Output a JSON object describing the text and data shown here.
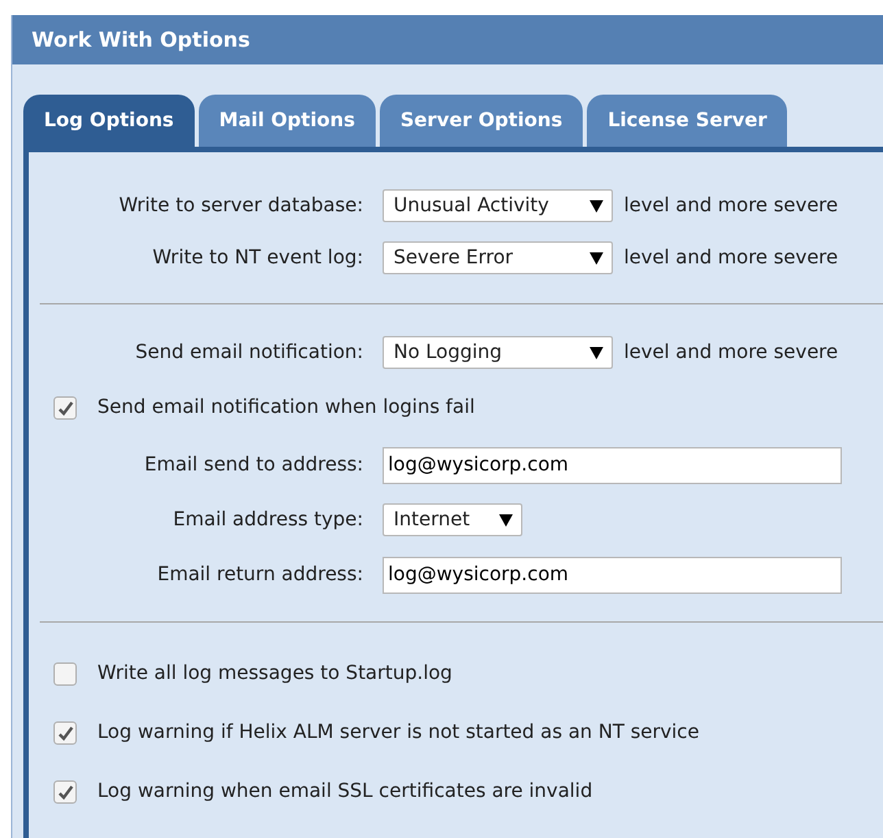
{
  "window": {
    "title": "Work With Options"
  },
  "tabs": [
    {
      "label": "Log Options",
      "selected": true
    },
    {
      "label": "Mail Options",
      "selected": false
    },
    {
      "label": "Server Options",
      "selected": false
    },
    {
      "label": "License Server",
      "selected": false
    }
  ],
  "sections": [
    {
      "rows": [
        {
          "kind": "select",
          "label": "Write to server database:",
          "value": "Unusual Activity",
          "suffix": "level and more severe"
        },
        {
          "kind": "select",
          "label": "Write to NT event log:",
          "value": "Severe Error",
          "suffix": "level and more severe"
        }
      ]
    },
    {
      "rows": [
        {
          "kind": "select",
          "label": "Send email notification:",
          "value": "No Logging",
          "suffix": "level and more severe"
        },
        {
          "kind": "checkbox",
          "label": "Send email notification when logins fail",
          "checked": true
        },
        {
          "kind": "input",
          "label": "Email send to address:",
          "value": "log@wysicorp.com"
        },
        {
          "kind": "small-select",
          "label": "Email address type:",
          "value": "Internet"
        },
        {
          "kind": "input",
          "label": "Email return address:",
          "value": "log@wysicorp.com"
        }
      ]
    },
    {
      "rows": [
        {
          "kind": "checkbox",
          "label": "Write all log messages to Startup.log",
          "checked": false
        },
        {
          "kind": "checkbox",
          "label": "Log warning if Helix ALM server is not started as an NT service",
          "checked": true
        },
        {
          "kind": "checkbox",
          "label": "Log warning when email SSL certificates are invalid",
          "checked": true
        }
      ]
    }
  ]
}
